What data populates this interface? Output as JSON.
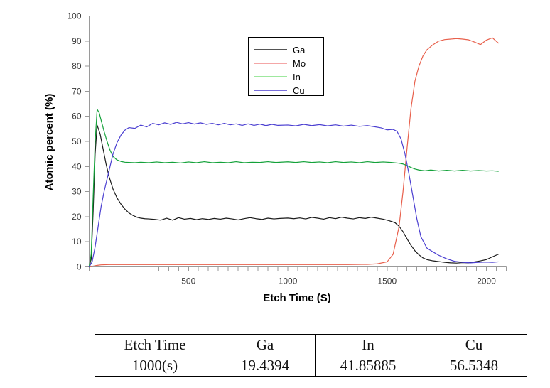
{
  "chart_data": {
    "type": "line",
    "title": "",
    "xlabel": "Etch Time (S)",
    "ylabel": "Atomic percent (%)",
    "xlim": [
      0,
      2100
    ],
    "ylim": [
      0,
      100
    ],
    "xticks": [
      500,
      1000,
      1500,
      2000
    ],
    "yticks": [
      0,
      10,
      20,
      30,
      40,
      50,
      60,
      70,
      80,
      90,
      100
    ],
    "grid": false,
    "legend_position": "top-center",
    "minor_tick_step": 50,
    "series": [
      {
        "name": "Ga",
        "color": "#1a1a1a",
        "x": [
          0,
          10,
          20,
          30,
          40,
          55,
          70,
          85,
          100,
          120,
          140,
          160,
          180,
          200,
          220,
          240,
          260,
          280,
          300,
          330,
          360,
          390,
          420,
          450,
          480,
          510,
          540,
          570,
          600,
          630,
          660,
          690,
          720,
          750,
          780,
          810,
          840,
          870,
          900,
          930,
          960,
          1000,
          1030,
          1060,
          1090,
          1120,
          1150,
          1180,
          1210,
          1240,
          1270,
          1300,
          1330,
          1360,
          1390,
          1420,
          1450,
          1480,
          1510,
          1540,
          1560,
          1580,
          1600,
          1620,
          1640,
          1660,
          1680,
          1700,
          1730,
          1760,
          1790,
          1820,
          1850,
          1880,
          1910,
          1940,
          1970,
          2000,
          2030,
          2060
        ],
        "y": [
          0,
          3,
          22,
          45,
          56.5,
          53,
          47,
          41,
          36,
          31,
          27.5,
          25,
          23,
          21.5,
          20.5,
          19.8,
          19.4,
          19.2,
          19.1,
          18.9,
          18.6,
          19.4,
          18.6,
          19.6,
          19.0,
          19.3,
          18.8,
          19.2,
          18.9,
          19.3,
          19.0,
          19.4,
          19.1,
          18.7,
          19.2,
          19.6,
          19.2,
          18.9,
          19.4,
          19.1,
          19.3,
          19.4394,
          19.2,
          19.5,
          19.1,
          19.7,
          19.4,
          19.0,
          19.6,
          19.2,
          19.8,
          19.4,
          19.1,
          19.6,
          19.3,
          19.8,
          19.4,
          19.0,
          18.4,
          17.6,
          16.2,
          14.0,
          11.2,
          8.6,
          6.4,
          4.8,
          3.6,
          2.9,
          2.4,
          2.1,
          1.8,
          1.6,
          1.5,
          1.7,
          1.6,
          2.0,
          2.4,
          2.9,
          4.0,
          5.0
        ]
      },
      {
        "name": "Mo",
        "color": "#e8604c",
        "x": [
          0,
          20,
          40,
          60,
          100,
          200,
          300,
          400,
          500,
          600,
          700,
          800,
          900,
          1000,
          1100,
          1200,
          1300,
          1400,
          1450,
          1500,
          1530,
          1560,
          1580,
          1600,
          1620,
          1640,
          1660,
          1680,
          1700,
          1730,
          1760,
          1790,
          1820,
          1850,
          1880,
          1910,
          1940,
          1970,
          2000,
          2030,
          2060
        ],
        "y": [
          0,
          0.3,
          0.6,
          0.8,
          0.9,
          0.9,
          0.9,
          0.9,
          0.9,
          0.9,
          0.9,
          0.9,
          0.9,
          0.9,
          0.9,
          0.9,
          0.9,
          1.0,
          1.2,
          2.0,
          5.0,
          16.0,
          30.0,
          47.0,
          63.0,
          74.0,
          80.0,
          84.0,
          86.5,
          88.5,
          90.0,
          90.6,
          90.8,
          91.0,
          90.8,
          90.5,
          89.6,
          88.6,
          90.4,
          91.3,
          89.2
        ]
      },
      {
        "name": "In",
        "color": "#13a139",
        "x": [
          0,
          10,
          20,
          30,
          40,
          50,
          60,
          75,
          90,
          105,
          120,
          140,
          160,
          180,
          200,
          230,
          260,
          300,
          340,
          380,
          420,
          460,
          500,
          540,
          580,
          620,
          660,
          700,
          740,
          780,
          820,
          860,
          900,
          940,
          1000,
          1040,
          1080,
          1120,
          1160,
          1200,
          1240,
          1280,
          1320,
          1360,
          1400,
          1440,
          1480,
          1520,
          1560,
          1580,
          1600,
          1620,
          1640,
          1660,
          1690,
          1720,
          1760,
          1800,
          1840,
          1880,
          1920,
          1960,
          2000,
          2030,
          2060
        ],
        "y": [
          0,
          5,
          28,
          50,
          62.8,
          61.5,
          58.5,
          54.0,
          50.0,
          46.5,
          44.0,
          42.6,
          42.0,
          41.7,
          41.6,
          41.5,
          41.7,
          41.5,
          41.8,
          41.5,
          41.7,
          41.4,
          41.8,
          41.5,
          41.9,
          41.5,
          41.7,
          41.5,
          41.9,
          41.5,
          41.7,
          41.6,
          41.9,
          41.6,
          41.85885,
          41.6,
          41.9,
          41.6,
          41.8,
          41.5,
          41.9,
          41.6,
          41.8,
          41.5,
          41.9,
          41.6,
          41.8,
          41.6,
          41.3,
          41.0,
          40.4,
          39.6,
          39.0,
          38.6,
          38.3,
          38.6,
          38.2,
          38.5,
          38.2,
          38.5,
          38.2,
          38.4,
          38.2,
          38.3,
          38.1
        ]
      },
      {
        "name": "Cu",
        "color": "#4b3fd1",
        "x": [
          0,
          15,
          30,
          45,
          60,
          75,
          90,
          105,
          120,
          140,
          160,
          180,
          200,
          230,
          260,
          290,
          320,
          350,
          380,
          410,
          440,
          470,
          500,
          530,
          560,
          590,
          620,
          650,
          680,
          710,
          740,
          770,
          800,
          830,
          860,
          890,
          920,
          950,
          1000,
          1040,
          1080,
          1120,
          1160,
          1200,
          1240,
          1280,
          1320,
          1360,
          1400,
          1440,
          1470,
          1500,
          1530,
          1550,
          1570,
          1590,
          1610,
          1630,
          1650,
          1670,
          1700,
          1730,
          1760,
          1800,
          1840,
          1880,
          1920,
          1960,
          2000,
          2030,
          2060
        ],
        "y": [
          0,
          2,
          8,
          16,
          24,
          30,
          35,
          40,
          45,
          49.5,
          52.5,
          54.5,
          55.5,
          55.2,
          56.5,
          55.8,
          57.2,
          56.6,
          57.4,
          56.8,
          57.6,
          57.0,
          57.5,
          56.9,
          57.4,
          56.8,
          57.2,
          56.6,
          57.2,
          56.6,
          57.0,
          56.4,
          57.0,
          56.4,
          56.9,
          56.3,
          56.8,
          56.4,
          56.5348,
          56.2,
          56.8,
          56.3,
          56.7,
          56.2,
          56.6,
          56.1,
          56.5,
          56.0,
          56.3,
          55.8,
          55.4,
          54.6,
          54.8,
          54.0,
          51.0,
          45.0,
          37.0,
          28.0,
          19.0,
          12.0,
          7.5,
          6.0,
          4.6,
          3.2,
          2.2,
          1.8,
          1.6,
          1.8,
          1.9,
          1.8,
          2.0
        ]
      }
    ]
  },
  "legend": {
    "entries": [
      {
        "label": "Ga",
        "color": "#1a1a1a"
      },
      {
        "label": "Mo",
        "color": "#f08a8a"
      },
      {
        "label": "In",
        "color": "#7ee07e"
      },
      {
        "label": "Cu",
        "color": "#4b3fd1"
      }
    ]
  },
  "table": {
    "headers": [
      "Etch  Time",
      "Ga",
      "In",
      "Cu"
    ],
    "rows": [
      [
        "1000(s)",
        "19.4394",
        "41.85885",
        "56.5348"
      ]
    ]
  }
}
